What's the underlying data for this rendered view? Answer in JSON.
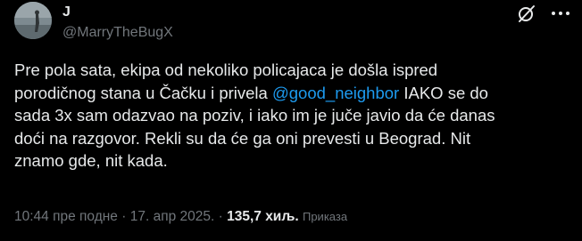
{
  "author": {
    "display_name": "J",
    "handle": "@MarryTheBugX"
  },
  "icons": {
    "grok": "grok-icon",
    "more": "more-options-icon",
    "avatar": "avatar-photo"
  },
  "tweet": {
    "text_part1": "Pre pola sata, ekipa od nekoliko policajaca je došla ispred\nporodičnog stana u Čačku i privela ",
    "mention": "@good_neighbor",
    "text_part2": " IAKO se do\nsada 3x sam odazvao na poziv, i iako im je juče javio da će danas\ndoći na razgovor. Rekli su da će ga oni prevesti u Beograd. Nit\nznamo gde, nit kada."
  },
  "meta": {
    "time": "10:44 пре подне",
    "separator": " · ",
    "date": "17. апр 2025.",
    "views_count": "135,7 хиљ.",
    "views_label": "Приказа"
  },
  "colors": {
    "background": "#000000",
    "text": "#e7e9ea",
    "secondary": "#71767b",
    "link": "#1d9bf0"
  }
}
